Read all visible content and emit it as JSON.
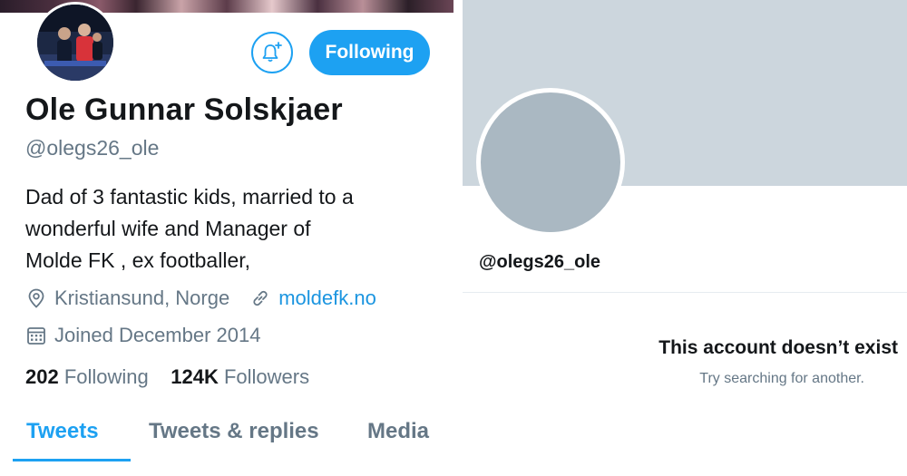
{
  "left_profile": {
    "avatar": "profile-photo",
    "bell_icon": "bell-plus-icon",
    "follow_button_label": "Following",
    "name": "Ole Gunnar Solskjaer",
    "handle": "@olegs26_ole",
    "bio_lines": [
      "Dad of 3 fantastic kids, married to a",
      "wonderful wife and Manager of",
      "Molde FK , ex footballer,"
    ],
    "location": "Kristiansund, Norge",
    "website": "moldefk.no",
    "joined": "Joined December 2014",
    "following_count": "202",
    "following_label": "Following",
    "followers_count": "124K",
    "followers_label": "Followers",
    "tabs": [
      {
        "label": "Tweets",
        "active": true
      },
      {
        "label": "Tweets & replies",
        "active": false
      },
      {
        "label": "Media",
        "active": false
      }
    ],
    "accent_color": "#1da1f2"
  },
  "right_profile": {
    "handle": "@olegs26_ole",
    "title": "This account doesn’t exist",
    "subtitle": "Try searching for another.",
    "banner_color": "#ccd6dd",
    "avatar_color": "#aab8c2"
  }
}
